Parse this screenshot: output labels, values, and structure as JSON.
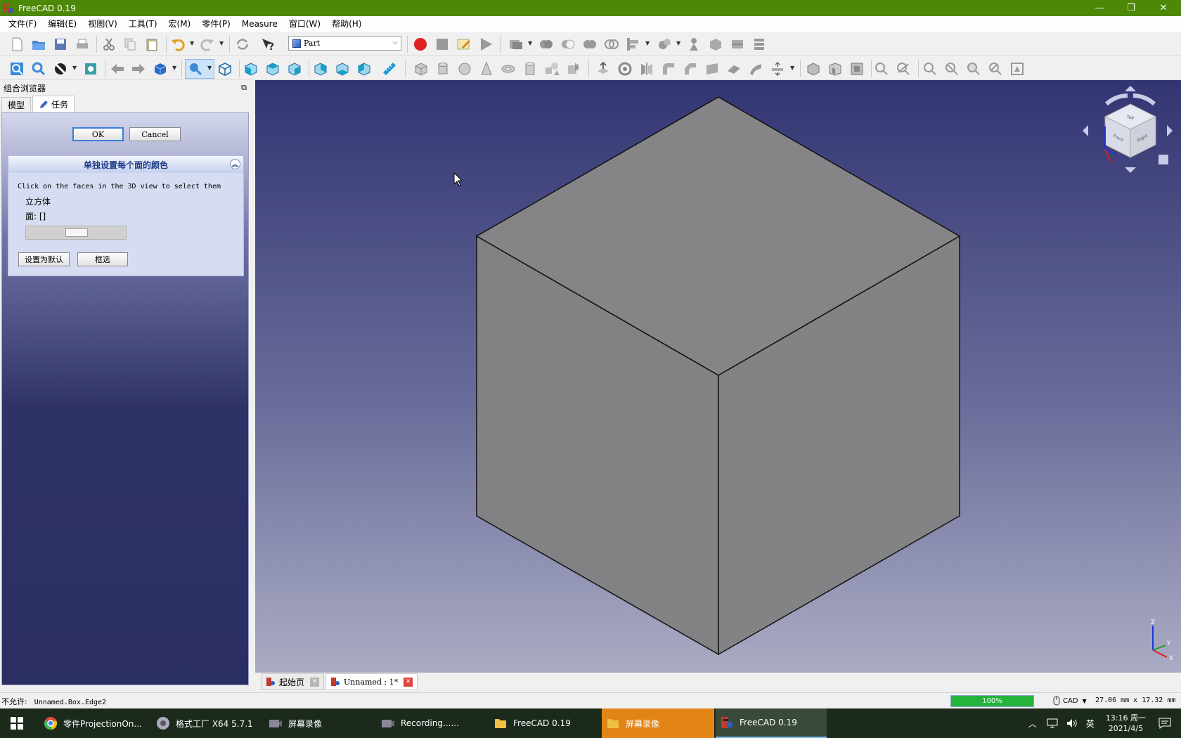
{
  "window": {
    "title": "FreeCAD 0.19",
    "minimize": "—",
    "restore": "❐",
    "close": "✕"
  },
  "menu": [
    "文件(F)",
    "编辑(E)",
    "视图(V)",
    "工具(T)",
    "宏(M)",
    "零件(P)",
    "Measure",
    "窗口(W)",
    "帮助(H)"
  ],
  "toolbar": {
    "workbench": "Part"
  },
  "combo_view": {
    "title": "组合浏览器",
    "tabs": [
      "模型",
      "任务"
    ],
    "active_tab": "任务"
  },
  "task": {
    "ok_label": "OK",
    "cancel_label": "Cancel",
    "box_title": "单独设置每个面的颜色",
    "hint": "Click on the faces in the 3D view to select them",
    "object_name": "立方体",
    "faces_label": "面: []",
    "set_default_label": "设置为默认",
    "box_select_label": "框选"
  },
  "view3d": {
    "background_top": "#323572",
    "background_bottom": "#aaacc4",
    "cube_color": "#858587",
    "navcube_faces": [
      "Top",
      "Front",
      "Right"
    ],
    "axis_labels": [
      "Z",
      "Y",
      "X"
    ]
  },
  "doc_tabs": [
    {
      "label": "起始页",
      "active": false
    },
    {
      "label": "Unnamed : 1*",
      "active": true
    }
  ],
  "status": {
    "prefix": "不允许:",
    "message": "Unnamed.Box.Edge2",
    "progress": "100%",
    "nav_style": "CAD",
    "dimensions": "27.06 mm x 17.32 mm"
  },
  "taskbar": {
    "items": [
      {
        "label": "零件ProjectionOn...",
        "icon": "chrome-icon"
      },
      {
        "label": "格式工厂 X64 5.7.1",
        "icon": "format-factory-icon"
      },
      {
        "label": "屏幕录像",
        "icon": "recorder-icon"
      },
      {
        "label": "Recording......",
        "icon": "recorder-icon"
      },
      {
        "label": "FreeCAD 0.19",
        "icon": "folder-icon"
      },
      {
        "label": "屏幕录像",
        "icon": "folder-icon"
      },
      {
        "label": "FreeCAD 0.19",
        "icon": "freecad-icon"
      }
    ],
    "tray": {
      "ime": "英",
      "time": "13:16 周一",
      "date": "2021/4/5"
    }
  }
}
